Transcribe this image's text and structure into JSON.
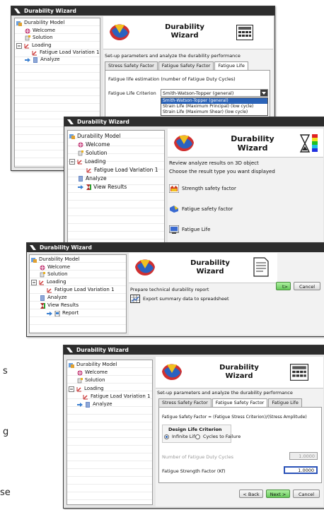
{
  "window_title": "Durability Wizard",
  "wizard_title_line1": "Durability",
  "wizard_title_line2": "Wizard",
  "tree": {
    "root": "Durability Model",
    "welcome": "Welcome",
    "solution": "Solution",
    "loading": "Loading",
    "variation": "Fatigue Load Variation 1",
    "analyze": "Analyze",
    "view_results": "View Results",
    "report": "Report"
  },
  "tabs": [
    "Stress Safety Factor",
    "Fatigue Safety Factor",
    "Fatigue Life"
  ],
  "w1": {
    "instruction": "Set-up parameters and analyze the durability performance",
    "estimation_label": "Fatigue life estimation (number of Fatigue Duty Cycles)",
    "criterion_label": "Fatigue Life Criterion",
    "criterion_value": "Smith-Watson-Topper (general)",
    "criterion_options": [
      "Smith-Watson-Topper (general)",
      "Strain Life (Maximum Principal) (low cycle)",
      "Strain Life (Maximum Shear) (low cycle)"
    ]
  },
  "w2": {
    "line1": "Review analyze results on 3D object",
    "line2": "Choose the result type you want displayed",
    "options": [
      "Strength safety factor",
      "Fatigue safety factor",
      "Fatigue Life"
    ]
  },
  "w3": {
    "instruction": "Prepare technical durability report",
    "export": "Export summary data to spreadsheet",
    "next_partial": "t>",
    "cancel": "Cancel"
  },
  "w4": {
    "instruction": "Set-up parameters and analyze the durability performance",
    "formula": "Fatigue Safety Factor = (Fatigue Stress Criterion)/(Stress Amplitude)",
    "criterion_heading": "Design Life Criterion",
    "radio_infinite": "Infinite Life",
    "radio_cycles": "Cycles to Failure",
    "duty_label": "Number of Fatigue Duty Cycles",
    "duty_value": "1.0000",
    "strength_label": "Fatigue Strength Factor (Kf)",
    "strength_value": "1.0000",
    "back": "< Back",
    "next": "Next >",
    "cancel": "Cancel"
  },
  "margin_fragments": [
    "s",
    "g",
    "se"
  ]
}
